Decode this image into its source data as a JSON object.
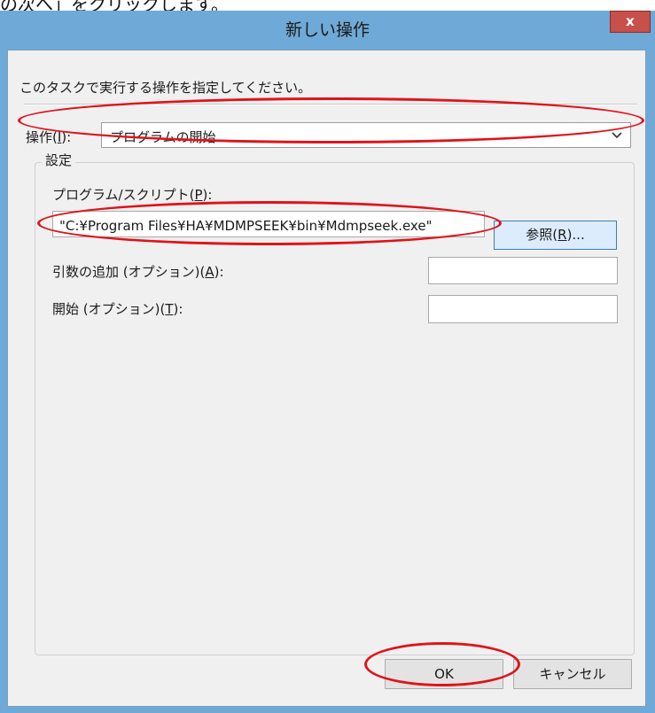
{
  "top_caption": "の次へ」をクリックします。",
  "window": {
    "title": "新しい操作",
    "close_label": "x"
  },
  "instruction": "このタスクで実行する操作を指定してください。",
  "action": {
    "label": "操作(",
    "mnemonic": "I",
    "label_suffix": "):",
    "selected_value": "プログラムの開始"
  },
  "settings": {
    "legend": "設定",
    "program_label": "プログラム/スクリプト(",
    "program_mnemonic": "P",
    "program_suffix": "):",
    "program_value": "\"C:¥Program Files¥HA¥MDMPSEEK¥bin¥Mdmpseek.exe\"",
    "browse_label": "参照(",
    "browse_mnemonic": "R",
    "browse_suffix": ")...",
    "args_label": "引数の追加 (オプション)(",
    "args_mnemonic": "A",
    "args_suffix": "):",
    "args_value": "",
    "start_label": "開始 (オプション)(",
    "start_mnemonic": "T",
    "start_suffix": "):",
    "start_value": ""
  },
  "buttons": {
    "ok_label": "OK",
    "cancel_label": "キャンセル"
  },
  "colors": {
    "highlight": "#e0131a",
    "window_frame": "#6fa9d7",
    "close_button": "#c7504a"
  }
}
